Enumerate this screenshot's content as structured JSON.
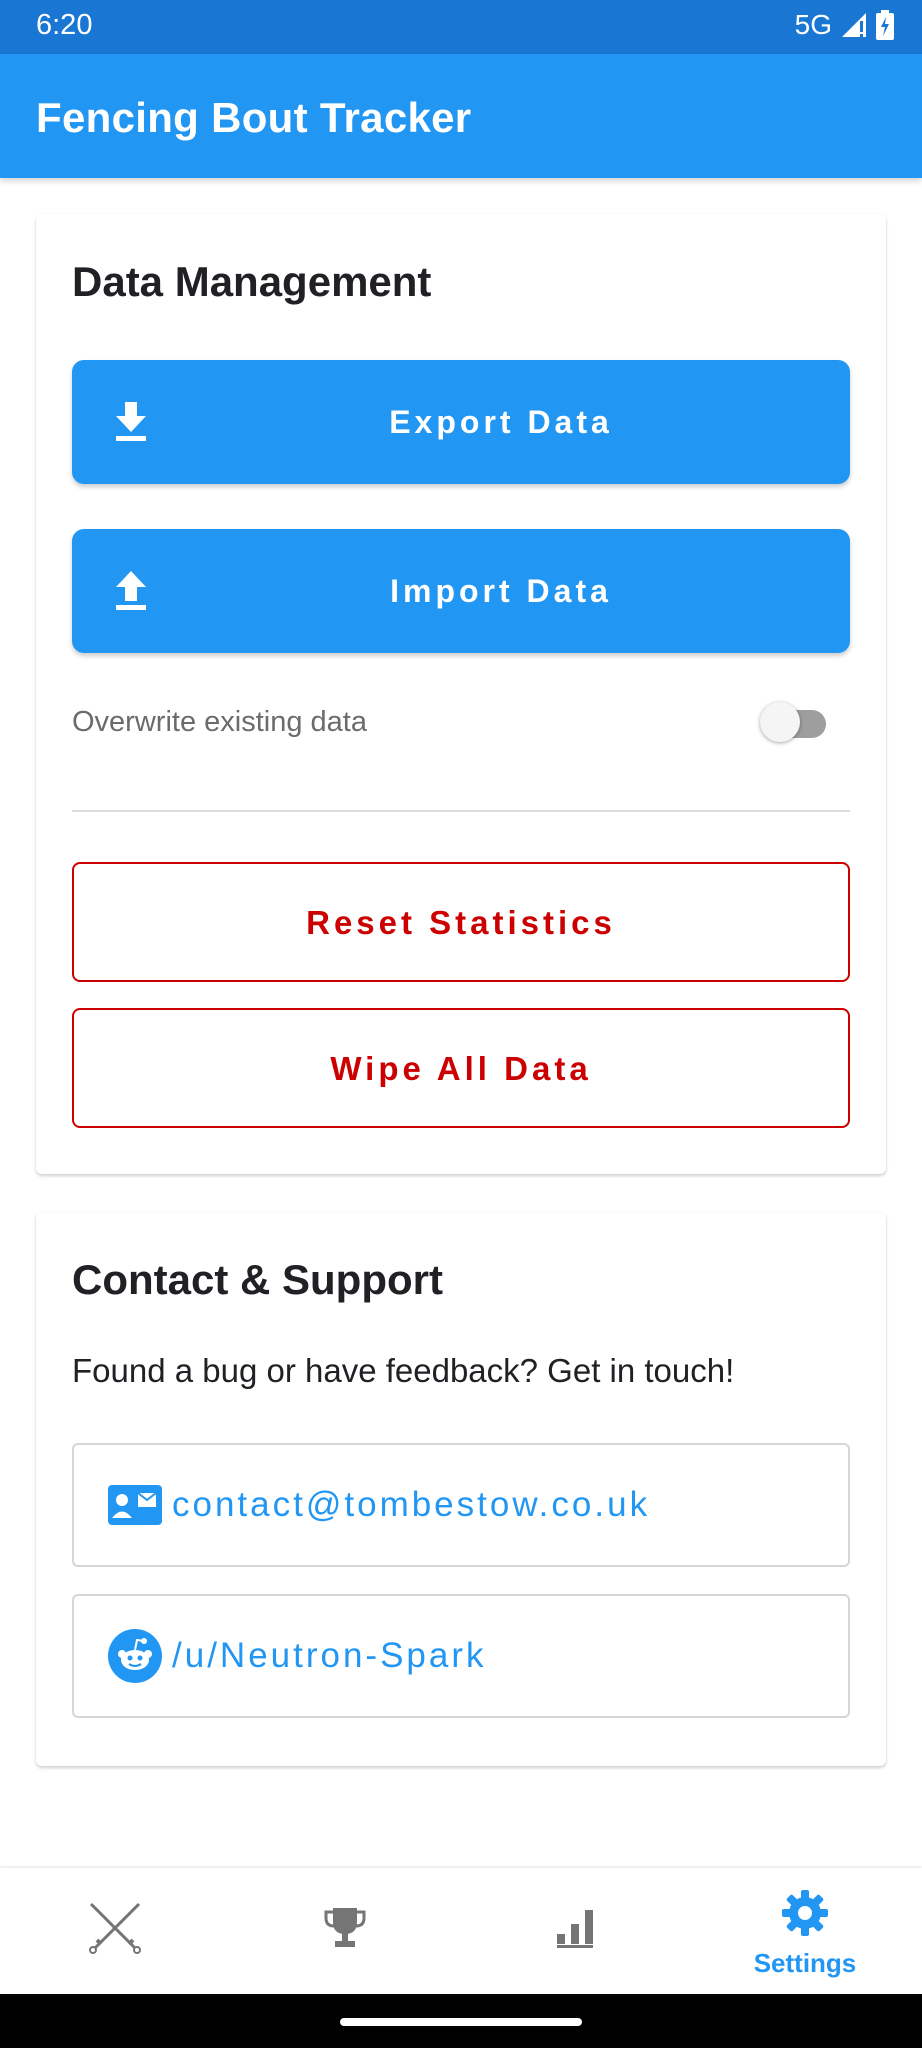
{
  "status_bar": {
    "time": "6:20",
    "network": "5G"
  },
  "app_bar": {
    "title": "Fencing Bout Tracker"
  },
  "data_management": {
    "title": "Data Management",
    "export_label": "Export Data",
    "import_label": "Import Data",
    "overwrite_label": "Overwrite existing data",
    "overwrite_enabled": false,
    "reset_label": "Reset Statistics",
    "wipe_label": "Wipe All Data"
  },
  "contact": {
    "title": "Contact & Support",
    "description": "Found a bug or have feedback? Get in touch!",
    "email": "contact@tombestow.co.uk",
    "reddit": "/u/Neutron-Spark"
  },
  "bottom_nav": {
    "items": [
      {
        "icon": "crossed-swords-icon",
        "label": ""
      },
      {
        "icon": "trophy-icon",
        "label": ""
      },
      {
        "icon": "bar-chart-icon",
        "label": ""
      },
      {
        "icon": "gear-icon",
        "label": "Settings",
        "active": true
      }
    ]
  },
  "colors": {
    "primary": "#2196f3",
    "status_bar": "#1976d2",
    "danger": "#cc0000"
  }
}
